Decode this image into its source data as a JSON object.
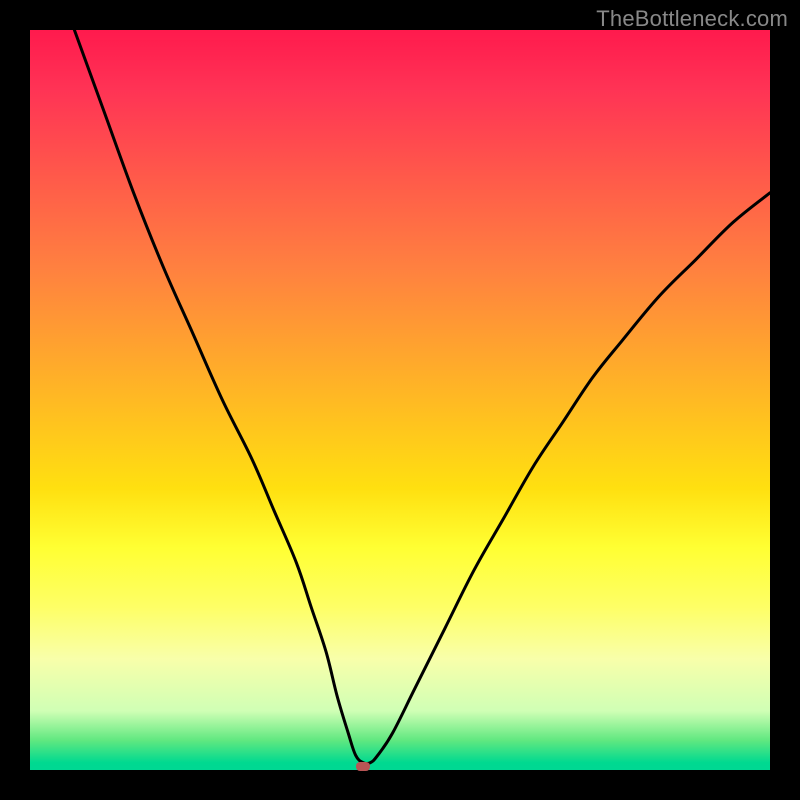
{
  "watermark": "TheBottleneck.com",
  "chart_data": {
    "type": "line",
    "title": "",
    "xlabel": "",
    "ylabel": "",
    "xlim": [
      0,
      100
    ],
    "ylim": [
      0,
      100
    ],
    "series": [
      {
        "name": "curve",
        "x": [
          6,
          10,
          14,
          18,
          22,
          26,
          30,
          33,
          36,
          38,
          40,
          41.5,
          43,
          44,
          45,
          46,
          47,
          49,
          52,
          56,
          60,
          64,
          68,
          72,
          76,
          80,
          85,
          90,
          95,
          100
        ],
        "values": [
          100,
          89,
          78,
          68,
          59,
          50,
          42,
          35,
          28,
          22,
          16,
          10,
          5,
          2,
          1,
          1,
          2,
          5,
          11,
          19,
          27,
          34,
          41,
          47,
          53,
          58,
          64,
          69,
          74,
          78
        ]
      }
    ],
    "marker": {
      "x": 45,
      "y": 0.6,
      "color": "#b85555"
    },
    "background_gradient": {
      "top": "#ff1a4d",
      "mid": "#ffe010",
      "bottom": "#00d893"
    }
  }
}
